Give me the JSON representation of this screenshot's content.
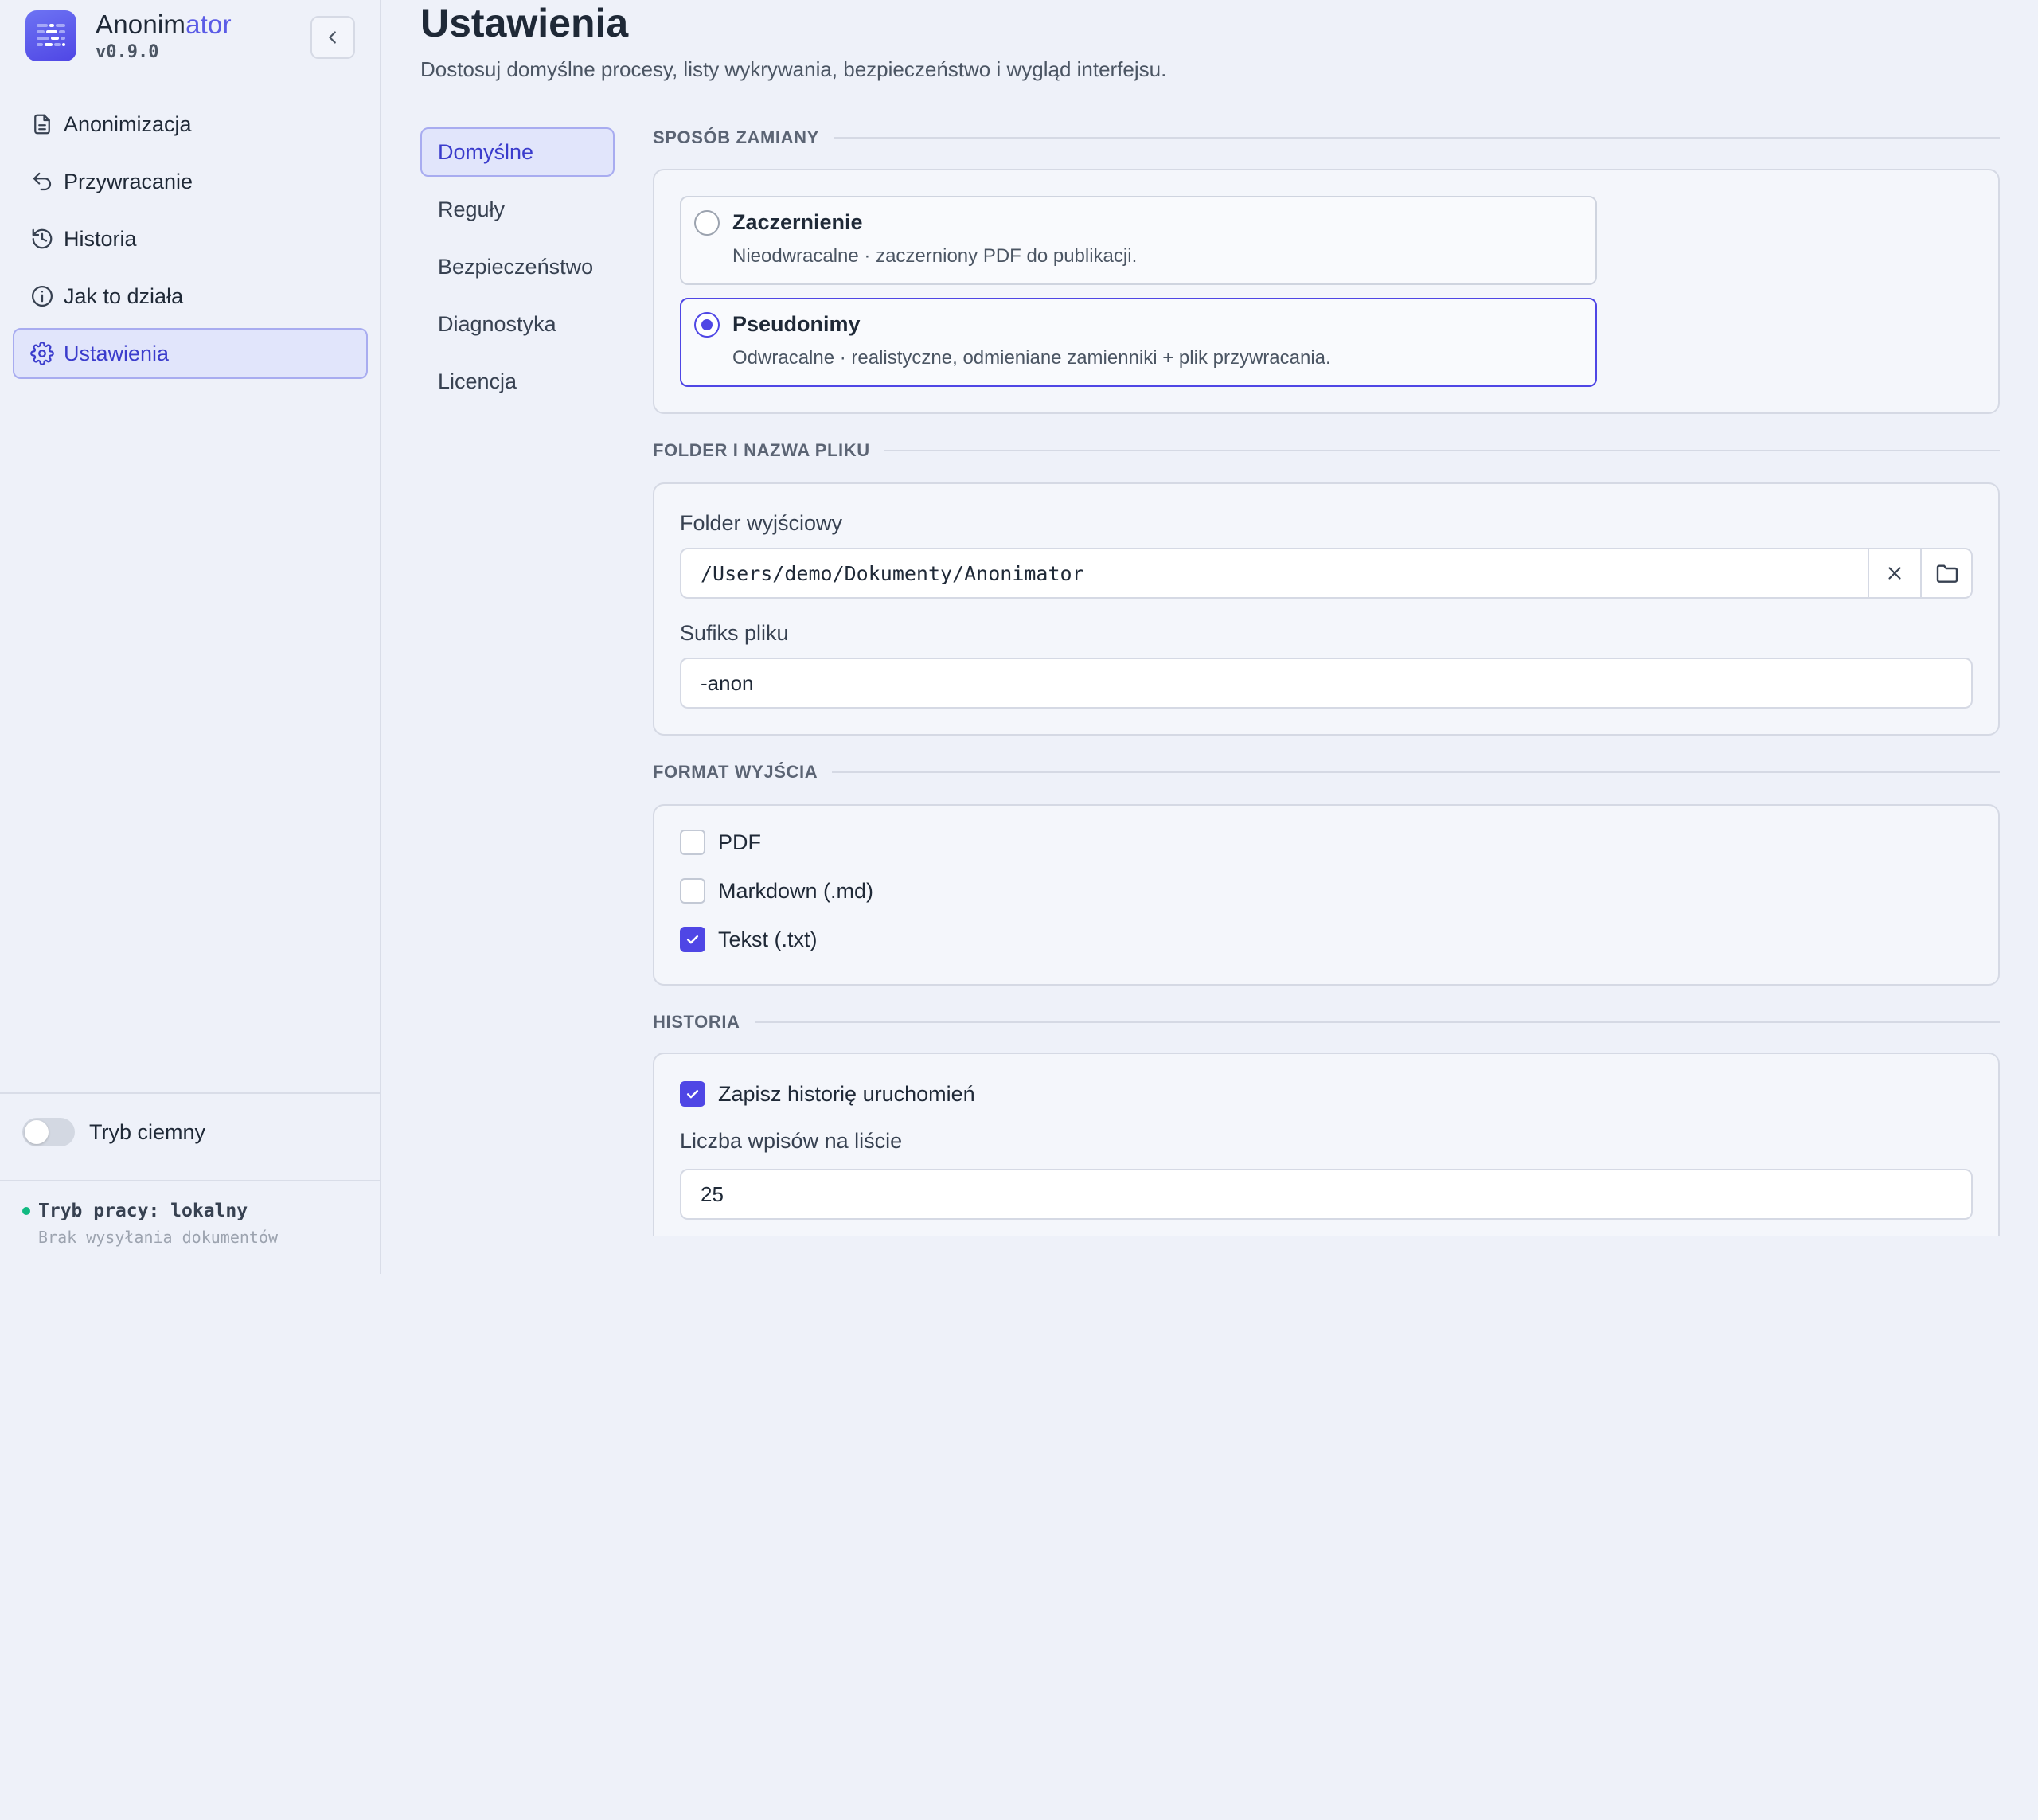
{
  "app": {
    "name_part1": "Anonim",
    "name_part2": "ator",
    "version": "v0.9.0"
  },
  "sidebar": {
    "items": [
      {
        "label": "Anonimizacja",
        "icon": "document-icon"
      },
      {
        "label": "Przywracanie",
        "icon": "undo-icon"
      },
      {
        "label": "Historia",
        "icon": "history-icon"
      },
      {
        "label": "Jak to działa",
        "icon": "info-icon"
      },
      {
        "label": "Ustawienia",
        "icon": "gear-icon",
        "active": true
      }
    ],
    "dark_mode_label": "Tryb ciemny",
    "dark_mode_on": false,
    "mode_title": "Tryb pracy: lokalny",
    "mode_sub": "Brak wysyłania dokumentów",
    "mode_dot_color": "#10b981"
  },
  "page": {
    "title": "Ustawienia",
    "subtitle": "Dostosuj domyślne procesy, listy wykrywania, bezpieczeństwo i wygląd interfejsu."
  },
  "subnav": {
    "items": [
      {
        "label": "Domyślne",
        "active": true
      },
      {
        "label": "Reguły"
      },
      {
        "label": "Bezpieczeństwo"
      },
      {
        "label": "Diagnostyka"
      },
      {
        "label": "Licencja"
      }
    ]
  },
  "sections": {
    "replace_mode": {
      "heading": "SPOSÓB ZAMIANY",
      "options": [
        {
          "title": "Zaczernienie",
          "desc": "Nieodwracalne · zaczerniony PDF do publikacji.",
          "selected": false
        },
        {
          "title": "Pseudonimy",
          "desc": "Odwracalne · realistyczne, odmieniane zamienniki + plik przywracania.",
          "selected": true
        }
      ]
    },
    "folder": {
      "heading": "FOLDER I NAZWA PLIKU",
      "output_label": "Folder wyjściowy",
      "output_value": "/Users/demo/Dokumenty/Anonimator",
      "suffix_label": "Sufiks pliku",
      "suffix_value": "-anon"
    },
    "format": {
      "heading": "FORMAT WYJŚCIA",
      "options": [
        {
          "label": "PDF",
          "checked": false
        },
        {
          "label": "Markdown (.md)",
          "checked": false
        },
        {
          "label": "Tekst (.txt)",
          "checked": true
        }
      ]
    },
    "history": {
      "heading": "HISTORIA",
      "save_label": "Zapisz historię uruchomień",
      "save_checked": true,
      "count_label": "Liczba wpisów na liście",
      "count_value": "25"
    }
  },
  "colors": {
    "accent": "#4f46e5",
    "background": "#eef1f9"
  }
}
